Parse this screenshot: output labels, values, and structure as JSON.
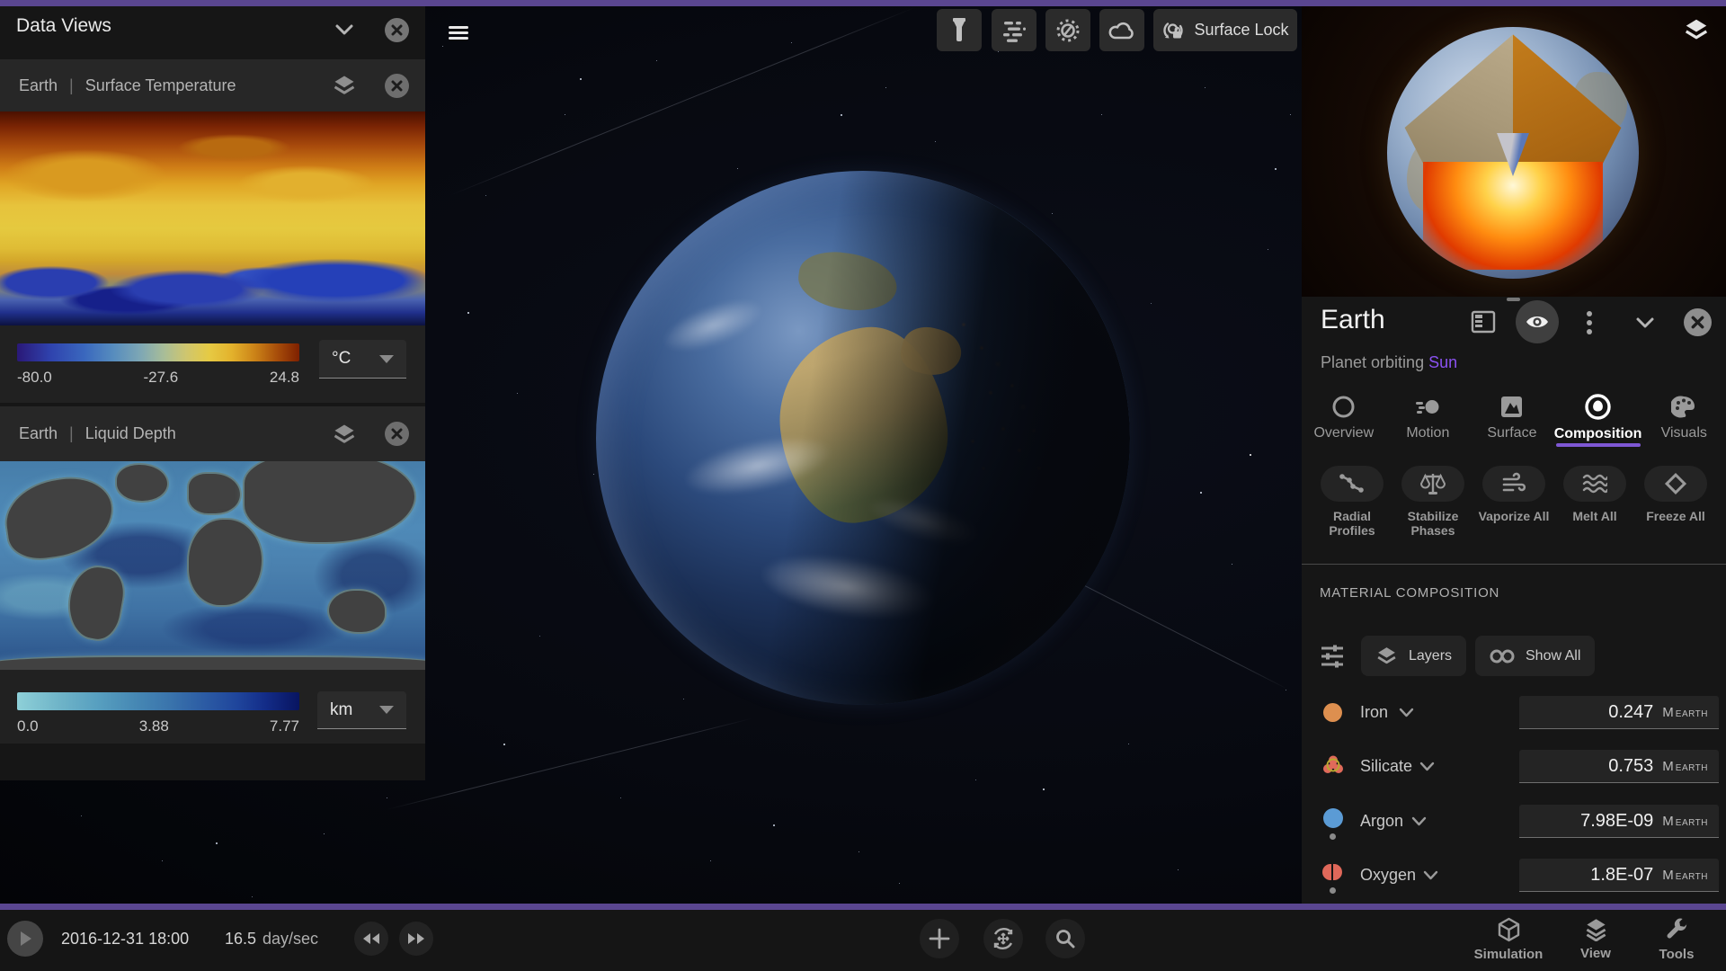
{
  "app": {
    "accent_purple": "#5a4690"
  },
  "left_panel": {
    "title": "Data Views",
    "cards": [
      {
        "object": "Earth",
        "separator": "|",
        "metric": "Surface Temperature",
        "scale": {
          "min": "-80.0",
          "mid": "-27.6",
          "max": "24.8"
        },
        "unit": "°C"
      },
      {
        "object": "Earth",
        "separator": "|",
        "metric": "Liquid Depth",
        "scale": {
          "min": "0.0",
          "mid": "3.88",
          "max": "7.77"
        },
        "unit": "km"
      }
    ]
  },
  "viewport": {
    "surface_lock": "Surface Lock"
  },
  "right_panel": {
    "title": "Earth",
    "subtitle": "Planet orbiting",
    "subtitle_link": "Sun",
    "tabs": [
      {
        "label": "Overview"
      },
      {
        "label": "Motion"
      },
      {
        "label": "Surface"
      },
      {
        "label": "Composition"
      },
      {
        "label": "Visuals"
      }
    ],
    "actions": [
      {
        "label": "Radial Profiles"
      },
      {
        "label": "Stabilize Phases"
      },
      {
        "label": "Vaporize All"
      },
      {
        "label": "Melt All"
      },
      {
        "label": "Freeze All"
      }
    ],
    "section_title": "MATERIAL COMPOSITION",
    "filters": {
      "layers": "Layers",
      "show_all": "Show All"
    },
    "unit_main": "M",
    "unit_sub": "EARTH",
    "materials": [
      {
        "name": "Iron",
        "value": "0.247",
        "color": "#dd8f4f"
      },
      {
        "name": "Silicate",
        "value": "0.753",
        "color": "#e06a5a"
      },
      {
        "name": "Argon",
        "value": "7.98E-09",
        "color": "#5b9bd5"
      },
      {
        "name": "Oxygen",
        "value": "1.8E-07",
        "color": "#e0685a"
      }
    ]
  },
  "bottom_bar": {
    "datetime": "2016-12-31 18:00",
    "rate_value": "16.5",
    "rate_unit": "day/sec",
    "menus": [
      {
        "label": "Simulation"
      },
      {
        "label": "View"
      },
      {
        "label": "Tools"
      }
    ]
  }
}
